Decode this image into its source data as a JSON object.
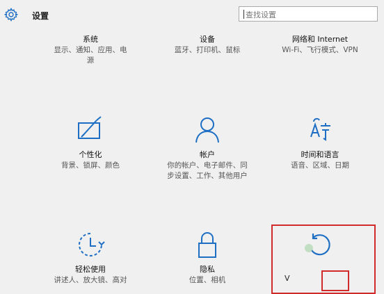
{
  "header": {
    "title": "设置",
    "search_placeholder": "查找设置"
  },
  "tiles": [
    {
      "name": "系统",
      "desc": "显示、通知、应用、电源",
      "icon": "none"
    },
    {
      "name": "设备",
      "desc": "蓝牙、打印机、鼠标",
      "icon": "none"
    },
    {
      "name": "网络和 Internet",
      "desc": "Wi-Fi、飞行模式、VPN",
      "icon": "none"
    },
    {
      "name": "个性化",
      "desc": "背景、锁屏、颜色",
      "icon": "personalization-icon"
    },
    {
      "name": "帐户",
      "desc": "你的帐户、电子邮件、同步设置、工作、其他用户",
      "icon": "account-icon"
    },
    {
      "name": "时间和语言",
      "desc": "语音、区域、日期",
      "icon": "time-language-icon"
    },
    {
      "name": "轻松使用",
      "desc": "讲述人、放大镜、高对",
      "icon": "ease-of-access-icon"
    },
    {
      "name": "隐私",
      "desc": "位置、相机",
      "icon": "privacy-lock-icon"
    }
  ],
  "highlight": {
    "letter": "V"
  },
  "colors": {
    "accent": "#1e6fc4",
    "highlight": "#d12a2a"
  }
}
